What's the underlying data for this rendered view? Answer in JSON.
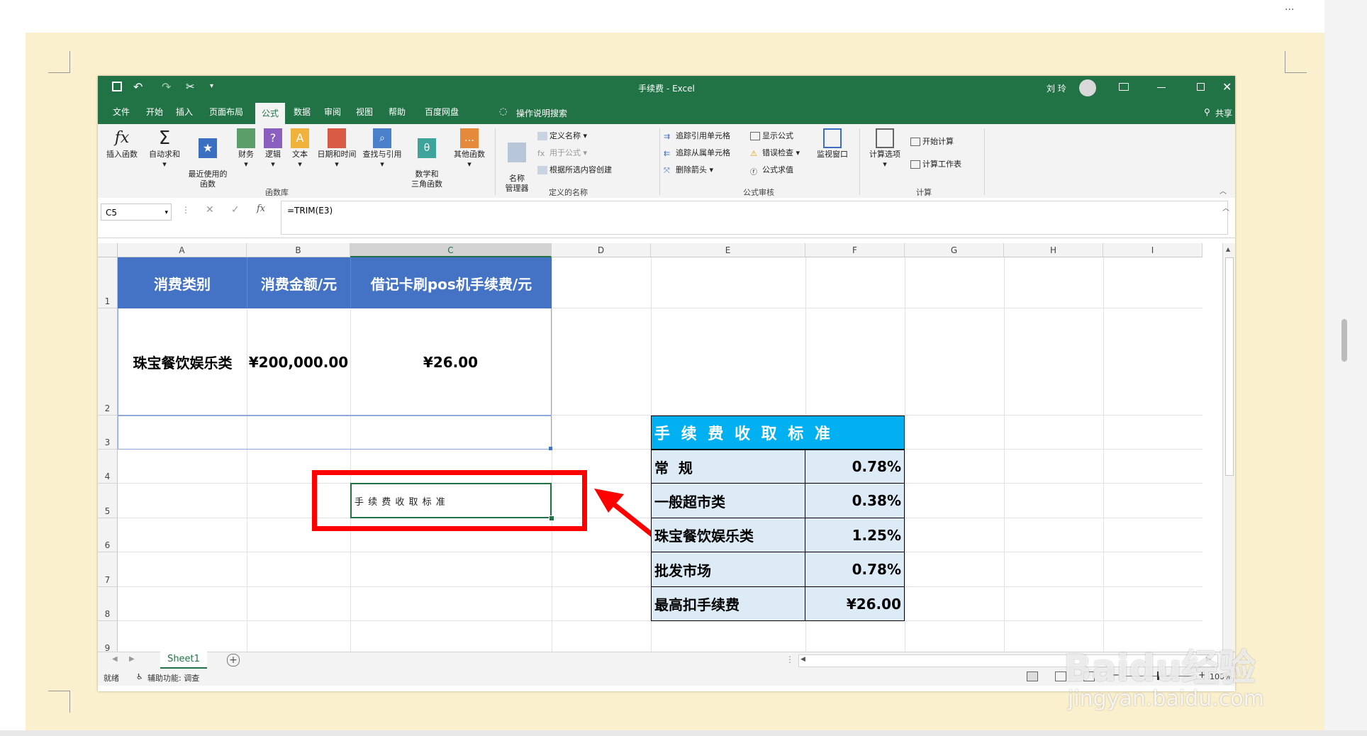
{
  "titlebar": {
    "title": "手续费 - Excel",
    "user": "刘 玲",
    "qat_extra": "▾"
  },
  "tabs": [
    "文件",
    "开始",
    "插入",
    "页面布局",
    "公式",
    "数据",
    "审阅",
    "视图",
    "帮助",
    "百度网盘"
  ],
  "active_tab": "公式",
  "tell_me": "操作说明搜索",
  "share": "共享",
  "ribbon": {
    "function_library": {
      "insert_function": "插入函数",
      "autosum": "自动求和",
      "recent": "最近使用的\n函数",
      "financial": "财务",
      "logical": "逻辑",
      "text": "文本",
      "datetime": "日期和时间",
      "lookup": "查找与引用",
      "math": "数学和\n三角函数",
      "more": "其他函数",
      "group_label": "函数库"
    },
    "defined_names": {
      "name_manager": "名称\n管理器",
      "define_name": "定义名称",
      "use_in_formula": "用于公式",
      "create_from_selection": "根据所选内容创建",
      "group_label": "定义的名称"
    },
    "formula_auditing": {
      "trace_precedents": "追踪引用单元格",
      "trace_dependents": "追踪从属单元格",
      "remove_arrows": "删除箭头",
      "show_formulas": "显示公式",
      "error_checking": "错误检查",
      "evaluate_formula": "公式求值",
      "watch_window": "监视窗口",
      "group_label": "公式审核"
    },
    "calculation": {
      "options": "计算选项",
      "calc_now": "开始计算",
      "calc_sheet": "计算工作表",
      "group_label": "计算"
    }
  },
  "formula_bar": {
    "name_box": "C5",
    "formula": "=TRIM(E3)",
    "fx": "fx"
  },
  "columns": [
    "A",
    "B",
    "C",
    "D",
    "E",
    "F",
    "G",
    "H",
    "I"
  ],
  "rows": [
    "1",
    "2",
    "3",
    "4",
    "5",
    "6",
    "7",
    "8",
    "9"
  ],
  "main_table": {
    "headers": [
      "消费类别",
      "消费金额/元",
      "借记卡刷pos机手续费/元"
    ],
    "row": [
      "珠宝餐饮娱乐类",
      "¥200,000.00",
      "¥26.00"
    ]
  },
  "selected_cell_value": "手 续 费 收 取 标 准",
  "fee_table": {
    "title": "手 续 费 收 取 标 准",
    "rows": [
      {
        "label": "常  规",
        "value": "0.78%"
      },
      {
        "label": "一般超市类",
        "value": "0.38%"
      },
      {
        "label": "珠宝餐饮娱乐类",
        "value": "1.25%"
      },
      {
        "label": "批发市场",
        "value": "0.78%"
      },
      {
        "label": "最高扣手续费",
        "value": "¥26.00"
      }
    ]
  },
  "sheet_tab": "Sheet1",
  "status": {
    "ready": "就绪",
    "accessibility": "辅助功能: 调查",
    "zoom": "100%"
  },
  "watermark": {
    "brand": "Baidu经验",
    "url": "jingyan.baidu.com"
  },
  "colors": {
    "excel_green": "#217346",
    "header_blue": "#4472c4",
    "fee_title_bg": "#00b0f0",
    "fee_row_bg": "#ddebf7",
    "highlight_red": "#ff0000",
    "page_bg": "#fbf0cd"
  }
}
